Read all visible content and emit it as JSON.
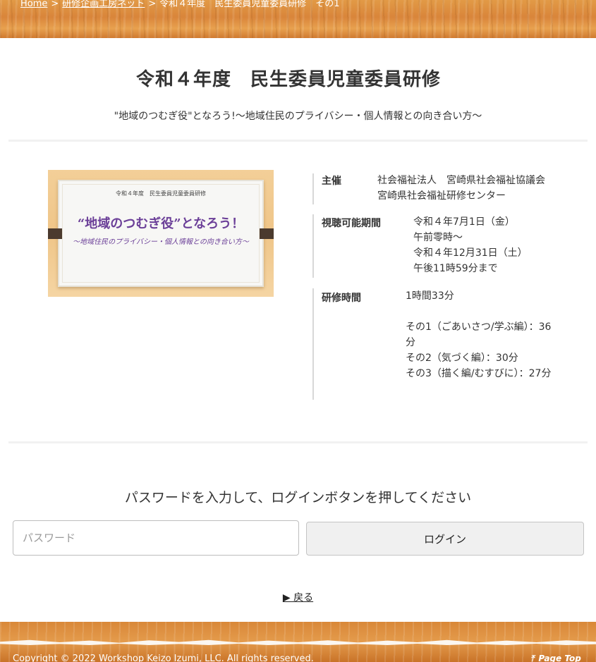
{
  "breadcrumb": {
    "home": "Home",
    "separator": ">",
    "parent": "研修企画工房ネット",
    "current": "令和４年度　民生委員児童委員研修　その1"
  },
  "page": {
    "title": "令和４年度　民生委員児童委員研修",
    "subtitle": "\"地域のつむぎ役\"となろう!～地域住民のプライバシー・個人情報との向き合い方～"
  },
  "thumbnail": {
    "line1": "令和４年度　民生委員児童委員研修",
    "line2": "“地域のつむぎ役”となろう！",
    "line3": "～地域住民のプライバシー・個人情報との向き合い方～"
  },
  "info": {
    "host": {
      "label": "主催",
      "lines": [
        "社会福祉法人　宮崎県社会福祉協議会",
        "宮崎県社会福祉研修センター"
      ]
    },
    "period": {
      "label": "視聴可能期間",
      "lines": [
        "令和４年7月1日（金）",
        "午前零時～",
        "令和４年12月31日（土）",
        "午後11時59分まで"
      ]
    },
    "duration": {
      "label": "研修時間",
      "total": "1時間33分",
      "parts": [
        "その1（ごあいさつ/学ぶ編）：36分",
        "その2（気づく編）：30分",
        "その3（描く編/むすびに）：27分"
      ]
    }
  },
  "login": {
    "prompt": "パスワードを入力して、ログインボタンを押してください",
    "password_placeholder": "パスワード",
    "button_label": "ログイン"
  },
  "back_link": "▶ 戻る",
  "footer": {
    "copyright": "Copyright © 2022 Workshop Keizo Izumi, LLC. All rights reserved.",
    "page_top_icon": "⤒",
    "page_top": "Page Top"
  },
  "colors": {
    "wood": "#e29a46",
    "thumbnail_text": "#6b3f98"
  }
}
